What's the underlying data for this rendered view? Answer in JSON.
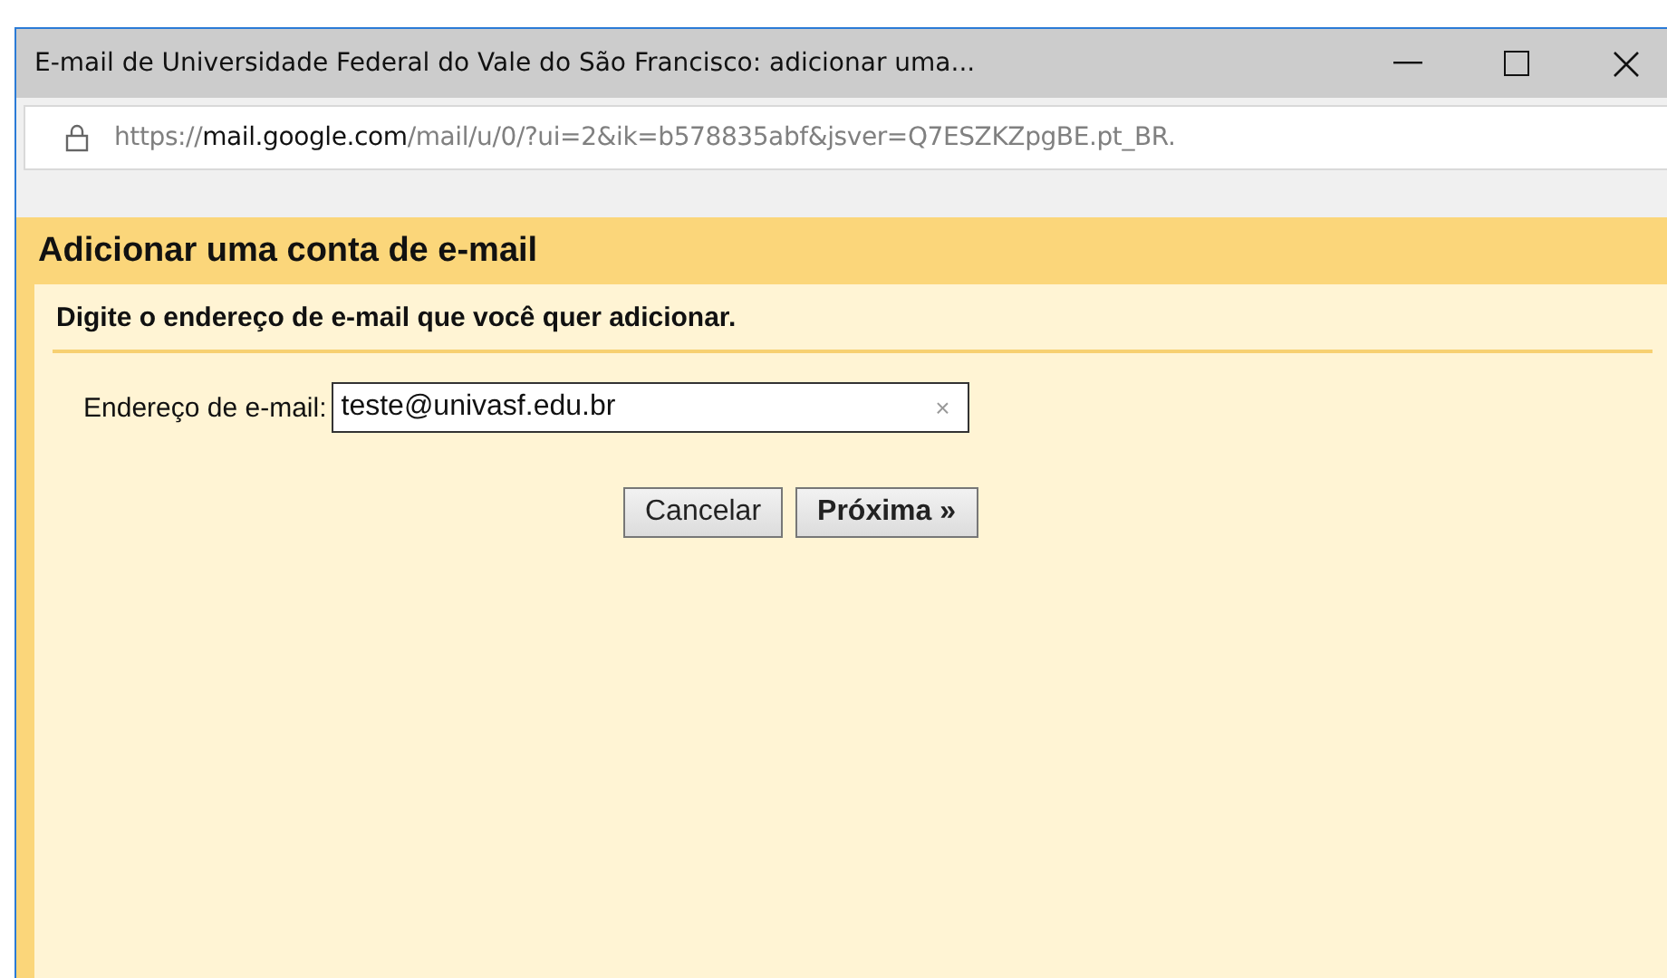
{
  "window": {
    "title": "E-mail de Universidade Federal do Vale do São Francisco: adicionar uma..."
  },
  "address_bar": {
    "scheme": "https://",
    "host": "mail.google.com",
    "path": "/mail/u/0/?ui=2&ik=b578835abf&jsver=Q7ESZKZpgBE.pt_BR."
  },
  "dialog": {
    "title": "Adicionar uma conta de e-mail",
    "instruction": "Digite o endereço de e-mail que você quer adicionar.",
    "field": {
      "label": "Endereço de e-mail:",
      "value": "teste@univasf.edu.br",
      "clear": "×"
    },
    "buttons": [
      {
        "label": "Cancelar",
        "kind": "plain"
      },
      {
        "label": "Próxima »",
        "kind": "primary"
      }
    ]
  }
}
